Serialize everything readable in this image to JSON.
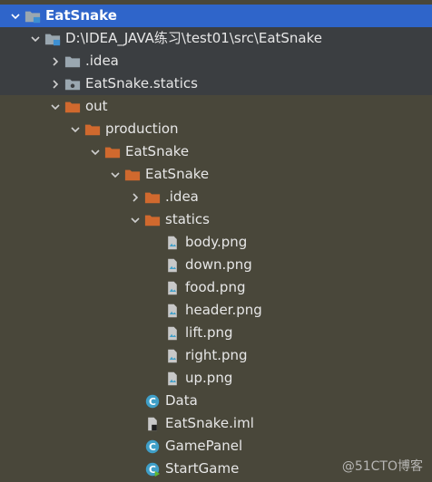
{
  "project_tree": {
    "root": {
      "label": "EatSnake"
    },
    "module": {
      "label": "D:\\IDEA_JAVA练习\\test01\\src\\EatSnake"
    },
    "idea_top": {
      "label": ".idea"
    },
    "statics_top": {
      "label": "EatSnake.statics"
    },
    "out": {
      "label": "out"
    },
    "production": {
      "label": "production"
    },
    "prod_module": {
      "label": "EatSnake"
    },
    "prod_pkg": {
      "label": "EatSnake"
    },
    "pkg_idea": {
      "label": ".idea"
    },
    "statics": {
      "label": "statics"
    },
    "files": [
      {
        "label": "body.png"
      },
      {
        "label": "down.png"
      },
      {
        "label": "food.png"
      },
      {
        "label": "header.png"
      },
      {
        "label": "lift.png"
      },
      {
        "label": "right.png"
      },
      {
        "label": "up.png"
      }
    ],
    "data_class": {
      "label": "Data"
    },
    "iml": {
      "label": "EatSnake.iml"
    },
    "gamepanel_class": {
      "label": "GamePanel"
    },
    "startgame_class": {
      "label": "StartGame"
    }
  },
  "watermark": "@51CTO博客",
  "colors": {
    "background": "#49473a",
    "selection": "#2f65ca",
    "folder_orange": "#d0692e",
    "folder_gray": "#9aa7b0",
    "class_icon": "#3f9fc8",
    "text": "#e7e7e7"
  }
}
